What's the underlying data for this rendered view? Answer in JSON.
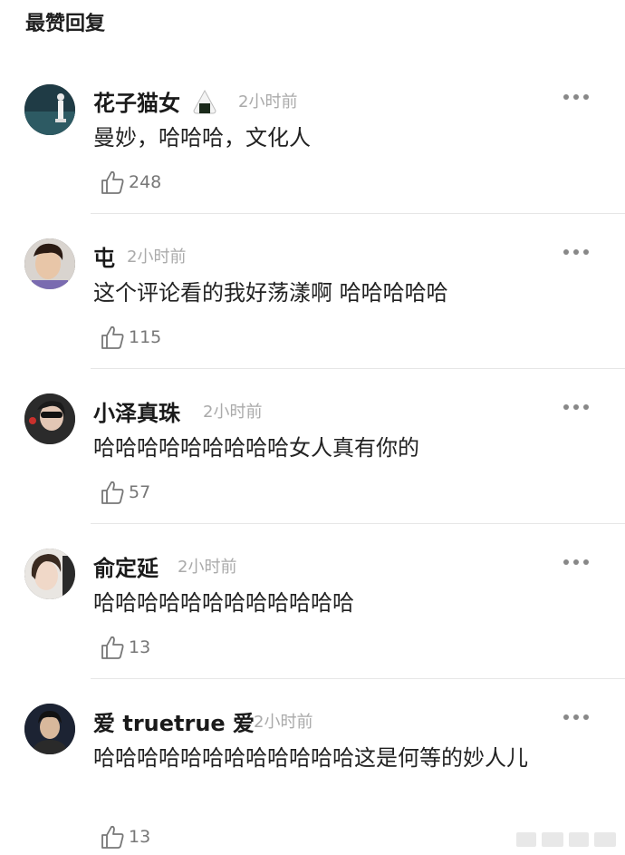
{
  "section": {
    "title": "最赞回复"
  },
  "comments": [
    {
      "username": "花子猫女",
      "time": "2小时前",
      "text": "曼妙，哈哈哈，文化人",
      "likes": "248",
      "badge": "rice-ball-icon"
    },
    {
      "username": "屯",
      "time": "2小时前",
      "text": "这个评论看的我好荡漾啊 哈哈哈哈哈",
      "likes": "115"
    },
    {
      "username": "小泽真珠",
      "time": "2小时前",
      "text": "哈哈哈哈哈哈哈哈哈女人真有你的",
      "likes": "57"
    },
    {
      "username": "俞定延",
      "time": "2小时前",
      "text": "哈哈哈哈哈哈哈哈哈哈哈哈",
      "likes": "13"
    },
    {
      "username": "爱 truetrue 爱",
      "time": "2小时前",
      "text": "哈哈哈哈哈哈哈哈哈哈哈哈这是何等的妙人儿",
      "likes": "13"
    }
  ],
  "colors": {
    "meta_text": "#aaaaaa",
    "divider": "#e6e6e6",
    "like_count": "#777777"
  }
}
